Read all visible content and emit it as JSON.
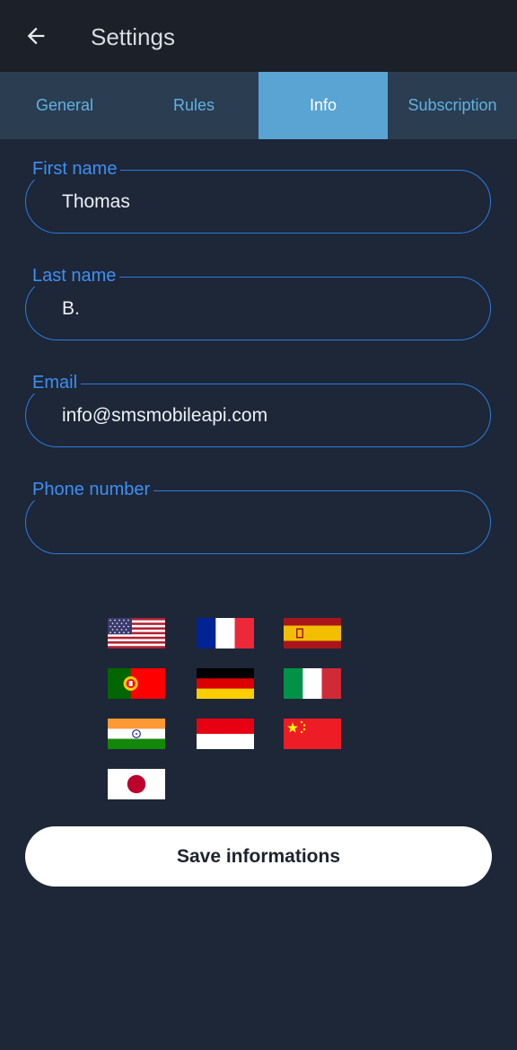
{
  "header": {
    "title": "Settings",
    "back_icon": "arrow-left-icon"
  },
  "tabs": [
    {
      "label": "General",
      "active": false
    },
    {
      "label": "Rules",
      "active": false
    },
    {
      "label": "Info",
      "active": true
    },
    {
      "label": "Subscription",
      "active": false
    }
  ],
  "form": {
    "first_name": {
      "label": "First name",
      "value": "Thomas"
    },
    "last_name": {
      "label": "Last name",
      "value": "B."
    },
    "email": {
      "label": "Email",
      "value": "info@smsmobileapi.com"
    },
    "phone": {
      "label": "Phone number",
      "value": ""
    }
  },
  "languages": [
    {
      "icon": "flag-us-icon"
    },
    {
      "icon": "flag-france-icon"
    },
    {
      "icon": "flag-spain-icon"
    },
    {
      "icon": "flag-portugal-icon"
    },
    {
      "icon": "flag-germany-icon"
    },
    {
      "icon": "flag-italy-icon"
    },
    {
      "icon": "flag-india-icon"
    },
    {
      "icon": "flag-indonesia-icon"
    },
    {
      "icon": "flag-china-icon"
    },
    {
      "icon": "flag-japan-icon"
    }
  ],
  "save_button": {
    "label": "Save informations"
  },
  "colors": {
    "background": "#1d2738",
    "appbar": "#1b2029",
    "tabbar": "#2b3d50",
    "tab_active": "#5aa4d4",
    "accent": "#2c7be0",
    "tab_text": "#5fb2e4"
  }
}
